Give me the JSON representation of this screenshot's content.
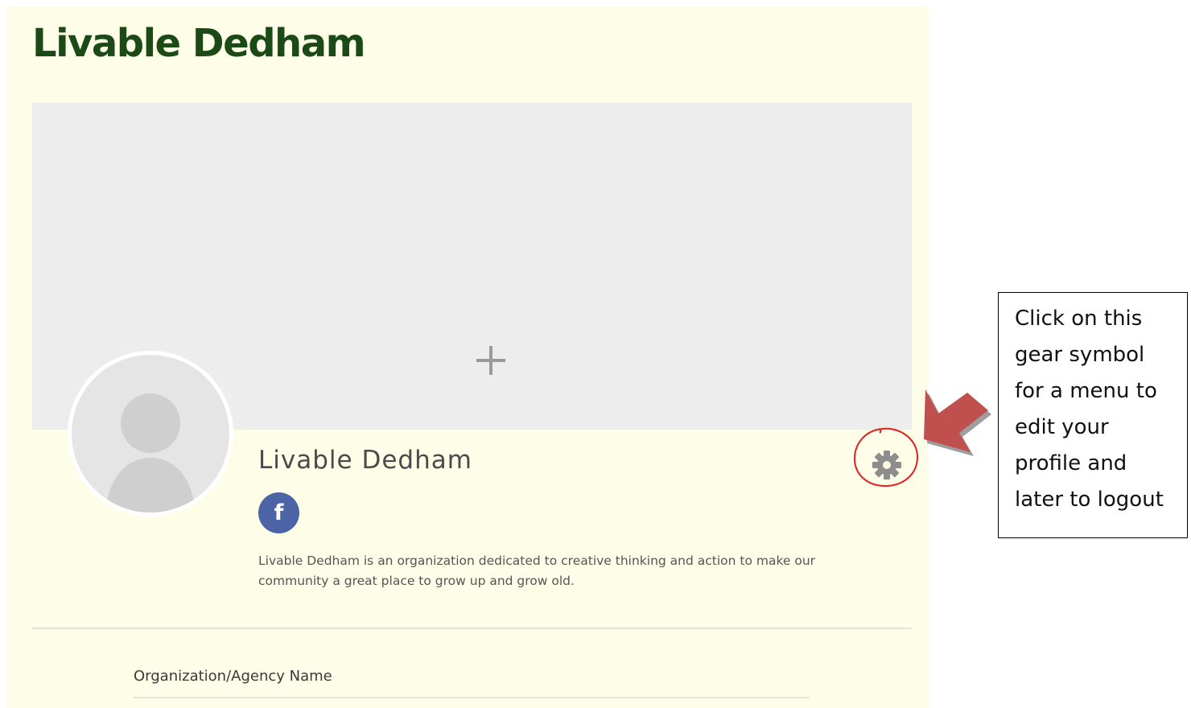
{
  "site": {
    "title": "Livable Dedham"
  },
  "cover": {
    "add_icon": "plus-icon"
  },
  "profile": {
    "avatar_icon": "user-silhouette-icon",
    "name": "Livable Dedham",
    "social": {
      "facebook_glyph": "f",
      "icon": "facebook-icon"
    },
    "description": "Livable Dedham is an organization dedicated to creative thinking and action to make our community a great place to grow up and grow old.",
    "settings_icon": "gear-icon"
  },
  "details": {
    "field_label": "Organization/Agency Name"
  },
  "annotation": {
    "lines": [
      "Click on this",
      "gear symbol",
      "for a menu to",
      "edit your",
      "profile and",
      "later to logout"
    ],
    "arrow_color": "#c0504d",
    "circle_color": "#e02020"
  },
  "colors": {
    "page_bg": "#fdfde8",
    "title": "#1b4a17",
    "facebook": "#4c63a6"
  }
}
